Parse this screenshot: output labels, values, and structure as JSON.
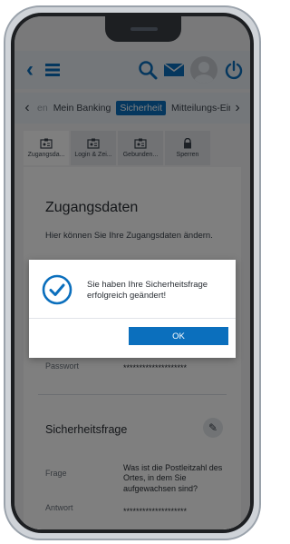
{
  "header": {
    "icons": [
      "back-icon",
      "menu-icon",
      "search-icon",
      "mail-icon",
      "avatar",
      "power-icon"
    ]
  },
  "nav": {
    "tabs": [
      {
        "label": "en",
        "state": "faded"
      },
      {
        "label": "Mein Banking",
        "state": "normal"
      },
      {
        "label": "Sicherheit",
        "state": "active"
      },
      {
        "label": "Mitteilungs-Ein",
        "state": "normal"
      }
    ],
    "left_chevron": "‹",
    "right_chevron": "›"
  },
  "subtabs": [
    {
      "label": "Zugangsda...",
      "icon": "id-card-icon",
      "active": true
    },
    {
      "label": "Login & Zei...",
      "icon": "id-card-icon",
      "active": false
    },
    {
      "label": "Gebunden...",
      "icon": "id-card-icon",
      "active": false
    },
    {
      "label": "Sperren",
      "icon": "lock-icon",
      "active": false
    }
  ],
  "content": {
    "title": "Zugangsdaten",
    "intro": "Hier können Sie Ihre Zugangsdaten ändern.",
    "password_label": "Passwort",
    "password_value": "********************",
    "security_title": "Sicherheitsfrage",
    "question_label": "Frage",
    "question_value": "Was ist die Postleitzahl des Ortes, in dem Sie aufgewachsen sind?",
    "answer_label": "Antwort",
    "answer_value": "********************"
  },
  "dialog": {
    "message": "Sie haben Ihre Sicherheitsfrage erfolgreich geändert!",
    "ok_label": "OK"
  },
  "colors": {
    "accent": "#0b6fbd",
    "overlay": "rgba(0,0,0,0.5)"
  }
}
